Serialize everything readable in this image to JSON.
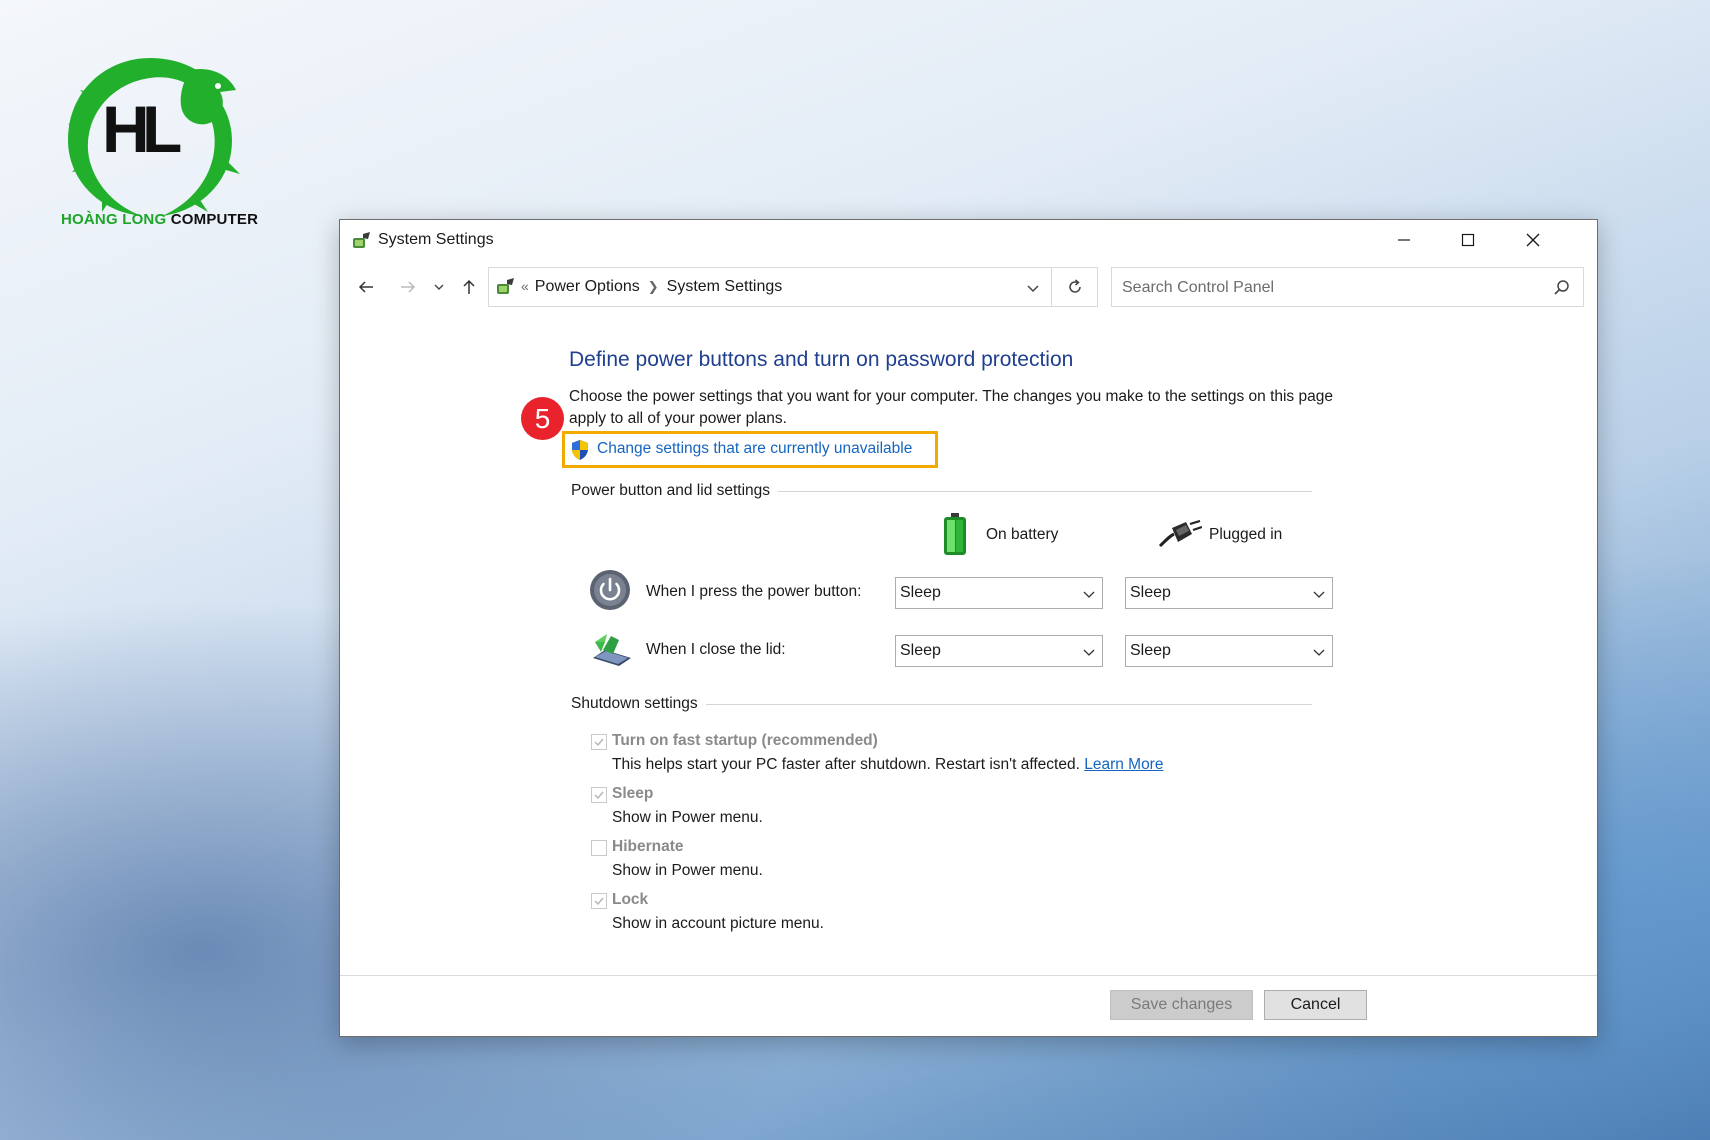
{
  "logo": {
    "brand_green": "HOÀNG LONG",
    "brand_dark": "COMPUTER",
    "color": "#1fa52a"
  },
  "window": {
    "title": "System Settings",
    "title_icon": "power-options-icon"
  },
  "nav": {
    "breadcrumb_prefix": "«",
    "breadcrumb": [
      "Power Options",
      "System Settings"
    ],
    "search_placeholder": "Search Control Panel"
  },
  "main": {
    "heading": "Define power buttons and turn on password protection",
    "description": "Choose the power settings that you want for your computer. The changes you make to the settings on this page apply to all of your power plans.",
    "step_badge": "5",
    "change_link": "Change settings that are currently unavailable",
    "highlight_color": "#f2a900"
  },
  "power_section": {
    "label": "Power button and lid settings",
    "columns": [
      "On battery",
      "Plugged in"
    ],
    "rows": [
      {
        "label": "When I press the power button:",
        "on_battery": "Sleep",
        "plugged_in": "Sleep",
        "icon": "power-button-icon"
      },
      {
        "label": "When I close the lid:",
        "on_battery": "Sleep",
        "plugged_in": "Sleep",
        "icon": "laptop-lid-icon"
      }
    ]
  },
  "shutdown_section": {
    "label": "Shutdown settings",
    "options": [
      {
        "title": "Turn on fast startup (recommended)",
        "desc": "This helps start your PC faster after shutdown. Restart isn't affected.",
        "link": "Learn More",
        "checked": true
      },
      {
        "title": "Sleep",
        "desc": "Show in Power menu.",
        "checked": true
      },
      {
        "title": "Hibernate",
        "desc": "Show in Power menu.",
        "checked": false
      },
      {
        "title": "Lock",
        "desc": "Show in account picture menu.",
        "checked": true
      }
    ]
  },
  "footer": {
    "save_label": "Save changes",
    "cancel_label": "Cancel"
  }
}
